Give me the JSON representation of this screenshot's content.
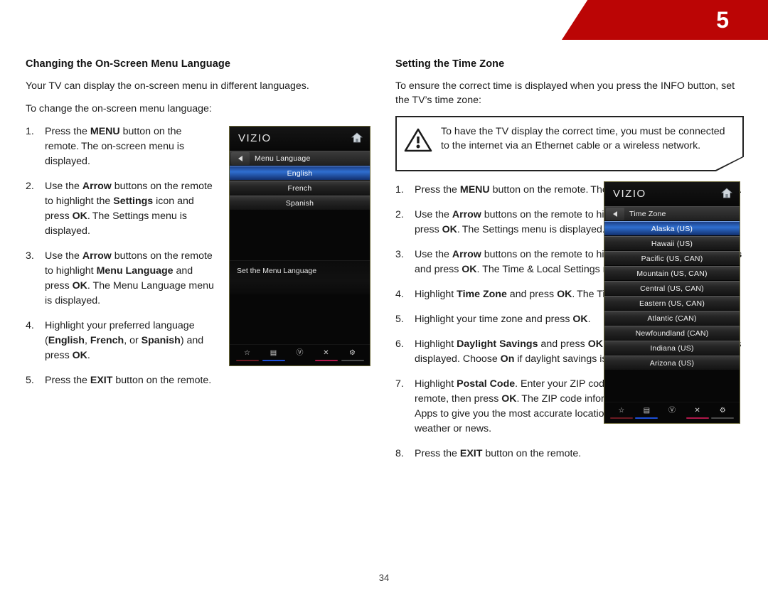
{
  "banner": {
    "chapter_number": "5",
    "color": "#bb0505"
  },
  "page_number": "34",
  "left_column": {
    "heading": "Changing the On-Screen Menu Language",
    "intro1": "Your TV can display the on-screen menu in different languages.",
    "intro2": "To change the on-screen menu language:",
    "steps": [
      {
        "num": "1.",
        "html": "Press the <b>MENU</b> button on the remote.&#8201;The on-screen menu is displayed."
      },
      {
        "num": "2.",
        "html": "Use the <b>Arrow</b> buttons on the remote to highlight the <b>Settings</b> icon and press <b>OK</b>.&#8201;The Settings menu is displayed."
      },
      {
        "num": "3.",
        "html": "Use the <b>Arrow</b> buttons on the remote to highlight <b>Menu Language</b> and press <b>OK</b>. The Menu Language menu is displayed."
      },
      {
        "num": "4.",
        "html": "Highlight your preferred language (<b>English</b>, <b>French</b>, or <b>Spanish</b>) and press <b>OK</b>."
      },
      {
        "num": "5.",
        "html": "Press the <b>EXIT</b> button on the remote."
      }
    ]
  },
  "right_column": {
    "heading": "Setting the Time Zone",
    "intro": "To ensure the correct time is displayed when you press the INFO button, set the TV’s time zone:",
    "note": {
      "icon": "warning-triangle-icon",
      "text": "To have the TV display the correct time, you must be connected to the internet via an Ethernet cable or a wireless network."
    },
    "steps": [
      {
        "num": "1.",
        "html": "Press the <b>MENU</b> button on the remote.&#8201;The on-screen menu is displayed."
      },
      {
        "num": "2.",
        "html": "Use the <b>Arrow</b> buttons on the remote to highlight the <b>Settings</b> icon and press <b>OK</b>.&#8201;The Settings menu is displayed."
      },
      {
        "num": "3.",
        "html": "Use the <b>Arrow</b> buttons on the remote to highlight <b>Time &amp; Local Settings</b> and press <b>OK</b>. The Time &amp; Local Settings menu is displayed."
      },
      {
        "num": "4.",
        "html": "Highlight <b>Time Zone</b> and press <b>OK</b>.&#8201;The Time Zone menu is displayed."
      },
      {
        "num": "5.",
        "html": "Highlight your time zone and press <b>OK</b>."
      },
      {
        "num": "6.",
        "html": "Highlight <b>Daylight Savings</b> and press <b>OK</b>.&#8201;The Daylight Savings menu is displayed. Choose <b>On</b> if daylight savings is in effect, or <b>Off</b> if it is not."
      },
      {
        "num": "7.",
        "html": "Highlight <b>Postal Code</b>. Enter your ZIP code using the keypad on the remote, then press <b>OK</b>.&#8201;The ZIP code information is often used by VIA Apps to give you the most accurate location-based information, such as weather or news."
      },
      {
        "num": "8.",
        "html": "Press the <b>EXIT</b> button on the remote."
      }
    ]
  },
  "tv_menu_language": {
    "brand": "VIZIO",
    "home_icon": "home-icon",
    "back_icon": "back-arrow-icon",
    "title": "Menu Language",
    "items": [
      {
        "label": "English",
        "selected": true
      },
      {
        "label": "French",
        "selected": false
      },
      {
        "label": "Spanish",
        "selected": false
      }
    ],
    "caption": "Set the Menu Language",
    "footer_icons": [
      {
        "name": "star-icon",
        "glyph": "☆",
        "bar_color": "#6b1a22"
      },
      {
        "name": "picture-icon",
        "glyph": "▤",
        "bar_color": "#1d4fd8"
      },
      {
        "name": "vizio-v-icon",
        "glyph": "Ⓥ",
        "bar_color": "transparent"
      },
      {
        "name": "close-x-icon",
        "glyph": "✕",
        "bar_color": "#b0184a"
      },
      {
        "name": "gear-icon",
        "glyph": "⚙",
        "bar_color": "#4a4a4a"
      }
    ]
  },
  "tv_time_zone": {
    "brand": "VIZIO",
    "home_icon": "home-icon",
    "back_icon": "back-arrow-icon",
    "title": "Time Zone",
    "items": [
      {
        "label": "Alaska (US)",
        "selected": true
      },
      {
        "label": "Hawaii (US)",
        "selected": false
      },
      {
        "label": "Pacific (US, CAN)",
        "selected": false
      },
      {
        "label": "Mountain (US, CAN)",
        "selected": false
      },
      {
        "label": "Central (US, CAN)",
        "selected": false
      },
      {
        "label": "Eastern (US, CAN)",
        "selected": false
      },
      {
        "label": "Atlantic (CAN)",
        "selected": false
      },
      {
        "label": "Newfoundland (CAN)",
        "selected": false
      },
      {
        "label": "Indiana (US)",
        "selected": false
      },
      {
        "label": "Arizona (US)",
        "selected": false
      }
    ],
    "caption": "",
    "footer_icons": [
      {
        "name": "star-icon",
        "glyph": "☆",
        "bar_color": "#6b1a22"
      },
      {
        "name": "picture-icon",
        "glyph": "▤",
        "bar_color": "#1d4fd8"
      },
      {
        "name": "vizio-v-icon",
        "glyph": "Ⓥ",
        "bar_color": "transparent"
      },
      {
        "name": "close-x-icon",
        "glyph": "✕",
        "bar_color": "#b0184a"
      },
      {
        "name": "gear-icon",
        "glyph": "⚙",
        "bar_color": "#4a4a4a"
      }
    ]
  }
}
